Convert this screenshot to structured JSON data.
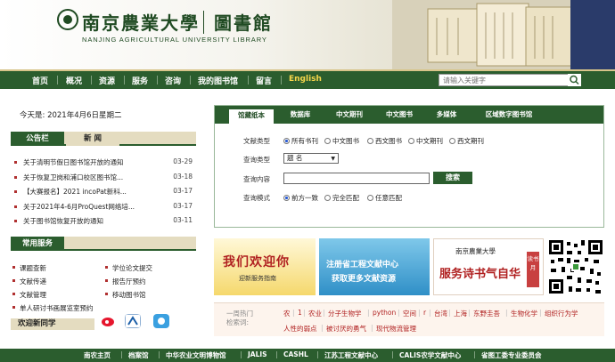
{
  "header": {
    "logo_cn": "南京農業大學",
    "logo_library": "圖書館",
    "logo_en": "NANJING AGRICULTURAL UNIVERSITY LIBRARY"
  },
  "nav": {
    "items": [
      "首页",
      "概况",
      "资源",
      "服务",
      "咨询",
      "我的图书馆",
      "留言",
      "English"
    ],
    "search_placeholder": "请输入关键字"
  },
  "date_text": "今天是: 2021年4月6日星期二",
  "news": {
    "tabs": [
      "公告栏",
      "新 闻"
    ],
    "items": [
      {
        "title": "关于清明节假日图书馆开放的通知",
        "date": "03-29"
      },
      {
        "title": "关于恢复卫岗和浦口校区图书馆...",
        "date": "03-18"
      },
      {
        "title": "【大赛报名】2021 incoPat新科...",
        "date": "03-17"
      },
      {
        "title": "关于2021年4-6月ProQuest网络培...",
        "date": "03-17"
      },
      {
        "title": "关于图书馆恢复开放的通知",
        "date": "03-11"
      }
    ]
  },
  "services": {
    "title": "常用服务",
    "items": [
      "课题查新",
      "学位论文提交",
      "文献传递",
      "报告厅预约",
      "文献管理",
      "移动图书馆",
      "单人研讨书画展览室预约"
    ],
    "welcome": "欢迎新同学"
  },
  "search_panel": {
    "tabs": [
      "馆藏纸本",
      "数据库",
      "中文期刊",
      "中文图书",
      "多媒体",
      "区域数字图书馆"
    ],
    "doc_type_label": "文献类型",
    "doc_types": [
      "所有书刊",
      "中文图书",
      "西文图书",
      "中文期刊",
      "西文期刊"
    ],
    "query_type_label": "查询类型",
    "query_type_value": "题 名",
    "query_content_label": "查询内容",
    "search_button": "搜索",
    "mode_label": "查询模式",
    "modes": [
      "前方一致",
      "完全匹配",
      "任意匹配"
    ]
  },
  "banners": {
    "welcome_title": "我们欢迎你",
    "welcome_sub": "迎新服务指南",
    "register_line1": "注册省工程文献中心",
    "register_line2": "获取更多文献资源",
    "reading_logo": "南京農業大學",
    "reading_title": "服务诗书气自华",
    "reading_tag": "读书月"
  },
  "hot": {
    "label_line1": "一周热门",
    "label_line2": "检索词:",
    "words": [
      "农",
      "1",
      "农业",
      "分子生物学",
      "python",
      "空间",
      "r",
      "台湾",
      "上海",
      "东野圭吾",
      "生物化学",
      "组织行为学",
      "人性的弱点",
      "被讨厌的勇气",
      "现代物流管理"
    ]
  },
  "footer": {
    "links": [
      "南农主页",
      "档案馆",
      "中华农业文明博物馆",
      "JALIS",
      "CASHL",
      "江苏工程文献中心",
      "CALIS农学文献中心",
      "省图工委专业委员会"
    ]
  },
  "colors": {
    "primary_green": "#2b5d2e",
    "accent_red": "#b02020",
    "tan": "#e4dcc0"
  }
}
